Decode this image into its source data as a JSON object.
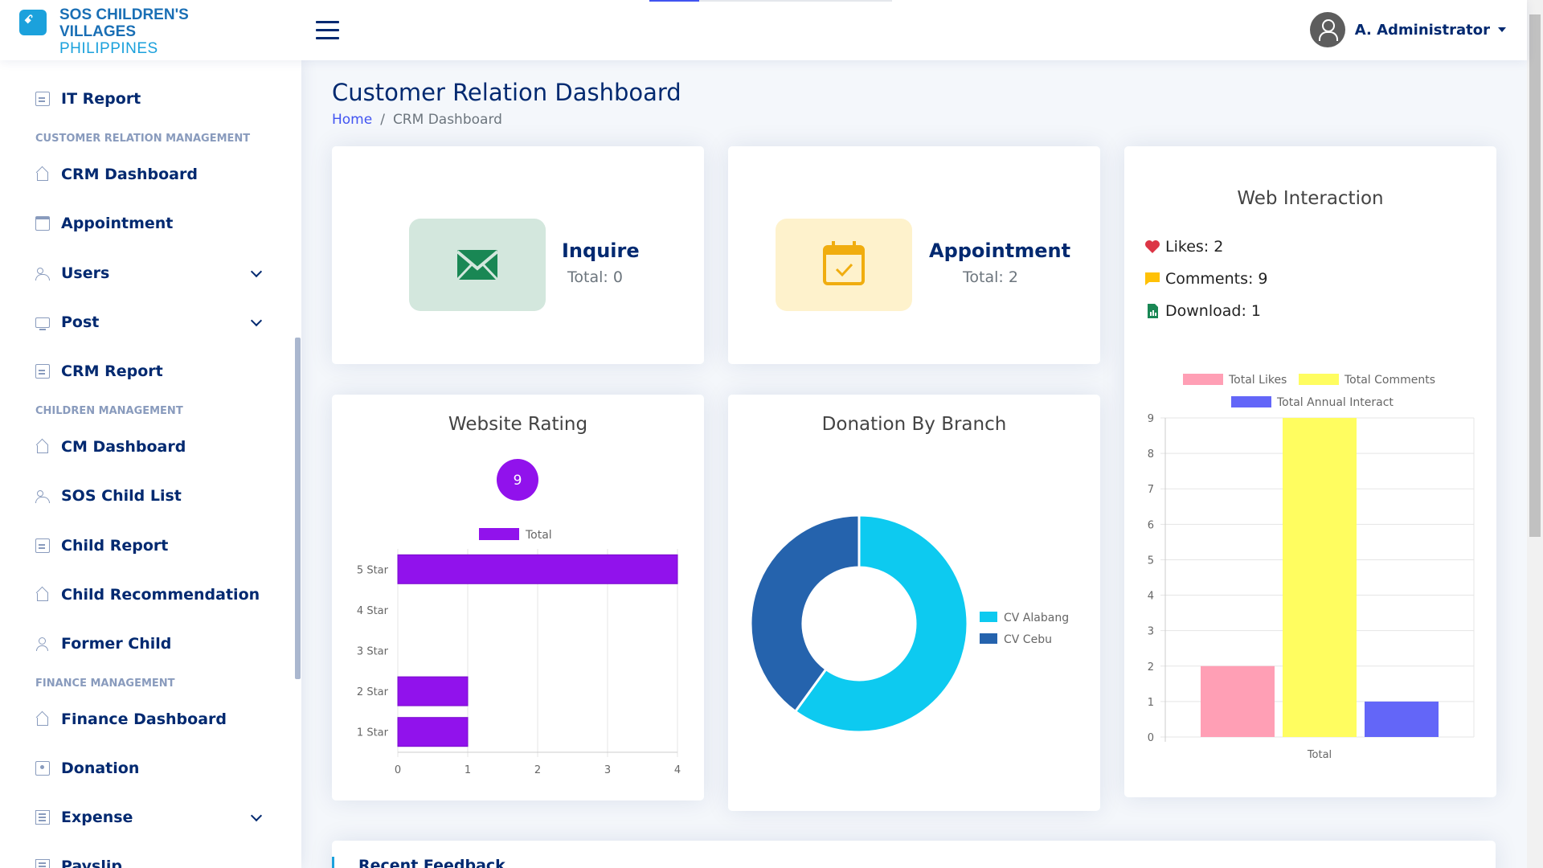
{
  "header": {
    "logo_line1": "SOS CHILDREN'S",
    "logo_line2": "VILLAGES",
    "logo_line3": "PHILIPPINES",
    "user_name": "A. Administrator"
  },
  "sidebar": {
    "items": [
      {
        "label": "IT Report",
        "icon": "document-icon"
      },
      {
        "heading": "CUSTOMER RELATION MANAGEMENT"
      },
      {
        "label": "CRM Dashboard",
        "icon": "house-icon"
      },
      {
        "label": "Appointment",
        "icon": "calendar-icon"
      },
      {
        "label": "Users",
        "icon": "users-icon"
      },
      {
        "label": "Post",
        "icon": "monitor-icon"
      },
      {
        "label": "CRM Report",
        "icon": "document-icon"
      },
      {
        "heading": "CHILDREN MANAGEMENT"
      },
      {
        "label": "CM Dashboard",
        "icon": "house-icon"
      },
      {
        "label": "SOS Child List",
        "icon": "users-icon"
      },
      {
        "label": "Child Report",
        "icon": "document-icon"
      },
      {
        "label": "Child Recommendation",
        "icon": "house-icon"
      },
      {
        "label": "Former Child",
        "icon": "person-icon"
      },
      {
        "heading": "FINANCE MANAGEMENT"
      },
      {
        "label": "Finance Dashboard",
        "icon": "house-icon"
      },
      {
        "label": "Donation",
        "icon": "donation-icon"
      },
      {
        "label": "Expense",
        "icon": "list-icon"
      },
      {
        "label": "Payslip",
        "icon": "list-icon"
      }
    ]
  },
  "main": {
    "title": "Customer Relation Dashboard",
    "breadcrumb_home": "Home",
    "breadcrumb_sep": "/",
    "breadcrumb_current": "CRM Dashboard",
    "inquire": {
      "title": "Inquire",
      "total": "Total: 0",
      "color": "#d3e7dd",
      "icon": "envelope-icon"
    },
    "appointment": {
      "title": "Appointment",
      "total": "Total: 2",
      "color": "#fef2cc",
      "icon": "calendar-check-icon"
    },
    "web_interaction": {
      "title": "Web Interaction",
      "likes": "Likes: 2",
      "comments": "Comments: 9",
      "download": "Download: 1"
    },
    "website_rating_title": "Website Rating",
    "donation_title": "Donation By Branch",
    "feedback_title": "Recent Feedback"
  },
  "chart_data": [
    {
      "type": "bar",
      "orientation": "horizontal",
      "title": "Website Rating",
      "badge": "9",
      "categories": [
        "5 Star",
        "4 Star",
        "3 Star",
        "2 Star",
        "1 Star"
      ],
      "series": [
        {
          "name": "Total",
          "values": [
            4,
            0,
            0,
            1,
            1
          ],
          "color": "#9112ec"
        }
      ],
      "xlim": [
        0,
        4
      ],
      "xticks": [
        "0",
        "1",
        "2",
        "3",
        "4"
      ]
    },
    {
      "type": "pie",
      "donut": true,
      "title": "Donation By Branch",
      "labels": [
        "CV Alabang",
        "CV Cebu"
      ],
      "values": [
        60,
        40
      ],
      "colors": [
        "#0dcaf0",
        "#2563ad"
      ]
    },
    {
      "type": "bar",
      "title": "",
      "categories": [
        "Total"
      ],
      "series": [
        {
          "name": "Total Likes",
          "values": [
            2
          ],
          "color": "#ff9fb5"
        },
        {
          "name": "Total Comments",
          "values": [
            9
          ],
          "color": "#fffd60"
        },
        {
          "name": "Total Annual Interact",
          "values": [
            1
          ],
          "color": "#6366f8"
        }
      ],
      "ylim": [
        0,
        9
      ],
      "yticks": [
        "0",
        "1",
        "2",
        "3",
        "4",
        "5",
        "6",
        "7",
        "8",
        "9"
      ]
    }
  ]
}
